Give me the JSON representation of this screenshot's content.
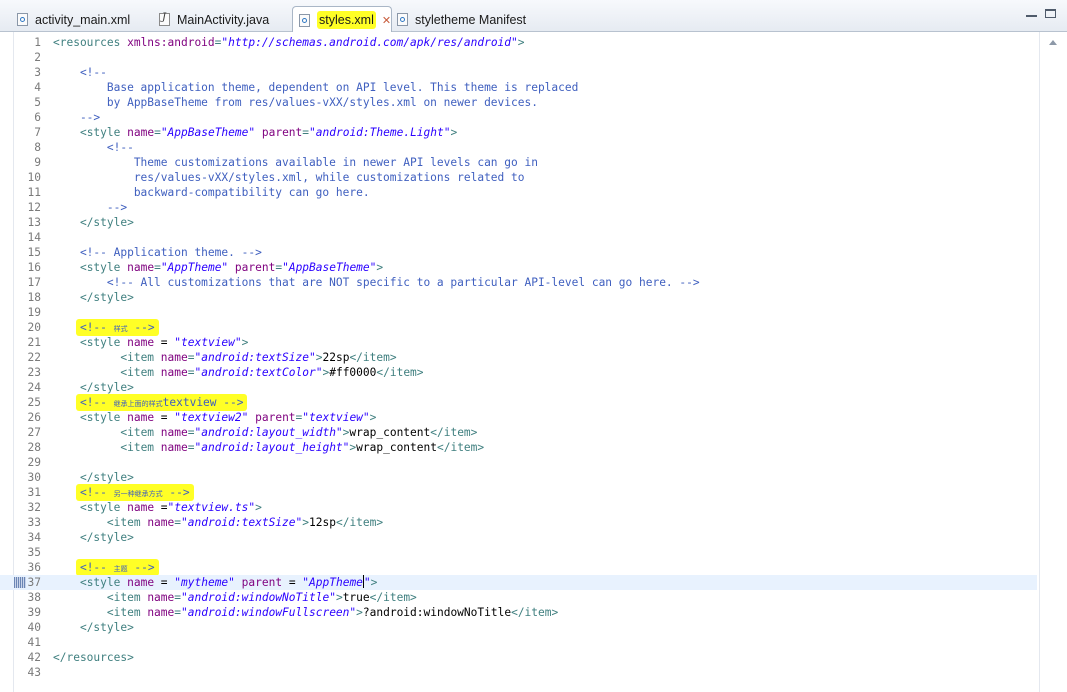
{
  "tabs": [
    {
      "label": "activity_main.xml",
      "icon": "xml-file-icon",
      "active": false,
      "highlight": false,
      "closable": false
    },
    {
      "label": "MainActivity.java",
      "icon": "java-file-icon",
      "active": false,
      "highlight": false,
      "closable": false
    },
    {
      "label": "styles.xml",
      "icon": "xml-file-icon",
      "active": true,
      "highlight": true,
      "closable": true
    },
    {
      "label": "styletheme Manifest",
      "icon": "xml-file-icon",
      "active": false,
      "highlight": false,
      "closable": false
    }
  ],
  "window_controls": [
    "minimize-icon",
    "maximize-icon"
  ],
  "editor": {
    "current_line": 37,
    "lines": [
      {
        "n": "1",
        "tokens": [
          [
            "tag",
            "<resources "
          ],
          [
            "attr",
            "xmlns:android"
          ],
          [
            "tag",
            "="
          ],
          [
            "val",
            "\"http://schemas.android.com/apk/res/android\""
          ],
          [
            "tag",
            ">"
          ]
        ]
      },
      {
        "n": "2",
        "tokens": []
      },
      {
        "n": "3",
        "tokens": [
          [
            "cmt",
            "    <!--"
          ]
        ]
      },
      {
        "n": "4",
        "tokens": [
          [
            "cmt",
            "        Base application theme, dependent on API level. This theme is replaced"
          ]
        ]
      },
      {
        "n": "5",
        "tokens": [
          [
            "cmt",
            "        by AppBaseTheme from res/values-vXX/styles.xml on newer devices."
          ]
        ]
      },
      {
        "n": "6",
        "tokens": [
          [
            "cmt",
            "    -->"
          ]
        ]
      },
      {
        "n": "7",
        "tokens": [
          [
            "txt",
            "    "
          ],
          [
            "tag",
            "<style "
          ],
          [
            "attr",
            "name"
          ],
          [
            "tag",
            "="
          ],
          [
            "val",
            "\"AppBaseTheme\""
          ],
          [
            "txt",
            " "
          ],
          [
            "attr",
            "parent"
          ],
          [
            "tag",
            "="
          ],
          [
            "val",
            "\"android:Theme.Light\""
          ],
          [
            "tag",
            ">"
          ]
        ]
      },
      {
        "n": "8",
        "tokens": [
          [
            "cmt",
            "        <!--"
          ]
        ]
      },
      {
        "n": "9",
        "tokens": [
          [
            "cmt",
            "            Theme customizations available in newer API levels can go in"
          ]
        ]
      },
      {
        "n": "10",
        "tokens": [
          [
            "cmt",
            "            res/values-vXX/styles.xml, while customizations related to"
          ]
        ]
      },
      {
        "n": "11",
        "tokens": [
          [
            "cmt",
            "            backward-compatibility can go here."
          ]
        ]
      },
      {
        "n": "12",
        "tokens": [
          [
            "cmt",
            "        -->"
          ]
        ]
      },
      {
        "n": "13",
        "tokens": [
          [
            "txt",
            "    "
          ],
          [
            "tag",
            "</style>"
          ]
        ]
      },
      {
        "n": "14",
        "tokens": []
      },
      {
        "n": "15",
        "tokens": [
          [
            "cmt",
            "    <!-- Application theme. -->"
          ]
        ]
      },
      {
        "n": "16",
        "tokens": [
          [
            "txt",
            "    "
          ],
          [
            "tag",
            "<style "
          ],
          [
            "attr",
            "name"
          ],
          [
            "tag",
            "="
          ],
          [
            "val",
            "\"AppTheme\""
          ],
          [
            "txt",
            " "
          ],
          [
            "attr",
            "parent"
          ],
          [
            "tag",
            "="
          ],
          [
            "val",
            "\"AppBaseTheme\""
          ],
          [
            "tag",
            ">"
          ]
        ]
      },
      {
        "n": "17",
        "tokens": [
          [
            "cmt",
            "        <!-- All customizations that are NOT specific to a particular API-level can go here. -->"
          ]
        ]
      },
      {
        "n": "18",
        "tokens": [
          [
            "txt",
            "    "
          ],
          [
            "tag",
            "</style>"
          ]
        ]
      },
      {
        "n": "19",
        "tokens": []
      },
      {
        "n": "20",
        "tokens": [
          [
            "txt",
            "    "
          ],
          [
            "hlcmt",
            "<!-- "
          ],
          [
            "hlcjk",
            "样式"
          ],
          [
            "hlcmt",
            " -->"
          ]
        ]
      },
      {
        "n": "21",
        "tokens": [
          [
            "txt",
            "    "
          ],
          [
            "tag",
            "<style "
          ],
          [
            "attr",
            "name"
          ],
          [
            "txt",
            " = "
          ],
          [
            "val",
            "\"textview\""
          ],
          [
            "tag",
            ">"
          ]
        ]
      },
      {
        "n": "22",
        "tokens": [
          [
            "txt",
            "          "
          ],
          [
            "tag",
            "<item "
          ],
          [
            "attr",
            "name"
          ],
          [
            "tag",
            "="
          ],
          [
            "val",
            "\"android:textSize\""
          ],
          [
            "tag",
            ">"
          ],
          [
            "txt",
            "22sp"
          ],
          [
            "tag",
            "</item>"
          ]
        ]
      },
      {
        "n": "23",
        "tokens": [
          [
            "txt",
            "          "
          ],
          [
            "tag",
            "<item "
          ],
          [
            "attr",
            "name"
          ],
          [
            "tag",
            "="
          ],
          [
            "val",
            "\"android:textColor\""
          ],
          [
            "tag",
            ">"
          ],
          [
            "txt",
            "#ff0000"
          ],
          [
            "tag",
            "</item>"
          ]
        ]
      },
      {
        "n": "24",
        "tokens": [
          [
            "txt",
            "    "
          ],
          [
            "tag",
            "</style>"
          ]
        ]
      },
      {
        "n": "25",
        "tokens": [
          [
            "txt",
            "    "
          ],
          [
            "hlcmt",
            "<!-- "
          ],
          [
            "hlcjk",
            "继承上面的样式"
          ],
          [
            "hlcmt",
            "textview -->"
          ]
        ]
      },
      {
        "n": "26",
        "tokens": [
          [
            "txt",
            "    "
          ],
          [
            "tag",
            "<style "
          ],
          [
            "attr",
            "name"
          ],
          [
            "txt",
            " = "
          ],
          [
            "val",
            "\"textview2\""
          ],
          [
            "txt",
            " "
          ],
          [
            "attr",
            "parent"
          ],
          [
            "tag",
            "="
          ],
          [
            "val",
            "\"textview\""
          ],
          [
            "tag",
            ">"
          ]
        ]
      },
      {
        "n": "27",
        "tokens": [
          [
            "txt",
            "          "
          ],
          [
            "tag",
            "<item "
          ],
          [
            "attr",
            "name"
          ],
          [
            "tag",
            "="
          ],
          [
            "val",
            "\"android:layout_width\""
          ],
          [
            "tag",
            ">"
          ],
          [
            "txt",
            "wrap_content"
          ],
          [
            "tag",
            "</item>"
          ]
        ]
      },
      {
        "n": "28",
        "tokens": [
          [
            "txt",
            "          "
          ],
          [
            "tag",
            "<item "
          ],
          [
            "attr",
            "name"
          ],
          [
            "tag",
            "="
          ],
          [
            "val",
            "\"android:layout_height\""
          ],
          [
            "tag",
            ">"
          ],
          [
            "txt",
            "wrap_content"
          ],
          [
            "tag",
            "</item>"
          ]
        ]
      },
      {
        "n": "29",
        "tokens": []
      },
      {
        "n": "30",
        "tokens": [
          [
            "txt",
            "    "
          ],
          [
            "tag",
            "</style>"
          ]
        ]
      },
      {
        "n": "31",
        "tokens": [
          [
            "txt",
            "    "
          ],
          [
            "hlcmt",
            "<!-- "
          ],
          [
            "hlcjk",
            "另一种继承方式"
          ],
          [
            "hlcmt",
            " -->"
          ]
        ]
      },
      {
        "n": "32",
        "tokens": [
          [
            "txt",
            "    "
          ],
          [
            "tag",
            "<style "
          ],
          [
            "attr",
            "name"
          ],
          [
            "txt",
            " ="
          ],
          [
            "val",
            "\"textview.ts\""
          ],
          [
            "tag",
            ">"
          ]
        ]
      },
      {
        "n": "33",
        "tokens": [
          [
            "txt",
            "        "
          ],
          [
            "tag",
            "<item "
          ],
          [
            "attr",
            "name"
          ],
          [
            "tag",
            "="
          ],
          [
            "val",
            "\"android:textSize\""
          ],
          [
            "tag",
            ">"
          ],
          [
            "txt",
            "12sp"
          ],
          [
            "tag",
            "</item>"
          ]
        ]
      },
      {
        "n": "34",
        "tokens": [
          [
            "txt",
            "    "
          ],
          [
            "tag",
            "</style>"
          ]
        ]
      },
      {
        "n": "35",
        "tokens": []
      },
      {
        "n": "36",
        "tokens": [
          [
            "txt",
            "    "
          ],
          [
            "hlcmt",
            "<!-- "
          ],
          [
            "hlcjk",
            "主题"
          ],
          [
            "hlcmt",
            " -->"
          ]
        ]
      },
      {
        "n": "37",
        "tokens": [
          [
            "txt",
            "    "
          ],
          [
            "tag",
            "<style "
          ],
          [
            "attr",
            "name"
          ],
          [
            "txt",
            " = "
          ],
          [
            "val",
            "\"mytheme\""
          ],
          [
            "txt",
            " "
          ],
          [
            "attr",
            "parent"
          ],
          [
            "txt",
            " = "
          ],
          [
            "val",
            "\"AppTheme"
          ],
          [
            "caret",
            ""
          ],
          [
            "val",
            "\""
          ],
          [
            "tag",
            ">"
          ]
        ]
      },
      {
        "n": "38",
        "tokens": [
          [
            "txt",
            "        "
          ],
          [
            "tag",
            "<item "
          ],
          [
            "attr",
            "name"
          ],
          [
            "tag",
            "="
          ],
          [
            "val",
            "\"android:windowNoTitle\""
          ],
          [
            "tag",
            ">"
          ],
          [
            "txt",
            "true"
          ],
          [
            "tag",
            "</item>"
          ]
        ]
      },
      {
        "n": "39",
        "tokens": [
          [
            "txt",
            "        "
          ],
          [
            "tag",
            "<item "
          ],
          [
            "attr",
            "name"
          ],
          [
            "tag",
            "="
          ],
          [
            "val",
            "\"android:windowFullscreen\""
          ],
          [
            "tag",
            ">"
          ],
          [
            "txt",
            "?android:windowNoTitle"
          ],
          [
            "tag",
            "</item>"
          ]
        ]
      },
      {
        "n": "40",
        "tokens": [
          [
            "txt",
            "    "
          ],
          [
            "tag",
            "</style>"
          ]
        ]
      },
      {
        "n": "41",
        "tokens": []
      },
      {
        "n": "42",
        "tokens": [
          [
            "tag",
            "</resources>"
          ]
        ]
      },
      {
        "n": "43",
        "tokens": []
      }
    ]
  },
  "colors": {
    "tag": "#3f7f7f",
    "attribute": "#7f007f",
    "value": "#2a00ff",
    "comment": "#3f5fbf",
    "highlight": "#ffff26",
    "current_line": "#e8f2fe"
  }
}
